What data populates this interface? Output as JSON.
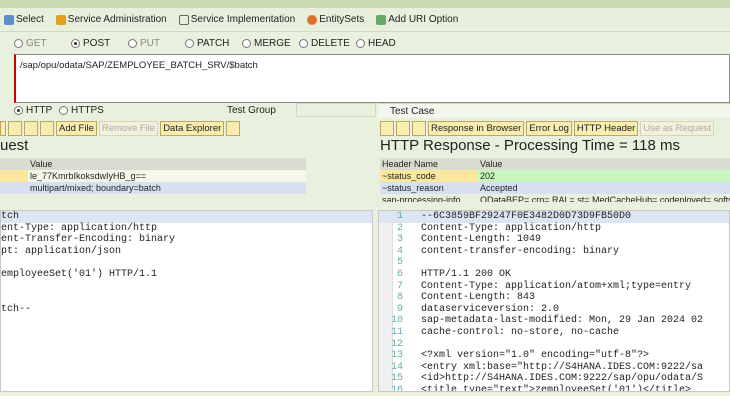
{
  "toolbar": {
    "items": [
      {
        "label": "Select",
        "icon": "select-icon"
      },
      {
        "label": "Service Administration",
        "icon": "service-admin-icon"
      },
      {
        "label": "Service Implementation",
        "icon": "service-impl-icon"
      },
      {
        "label": "EntitySets",
        "icon": "entitysets-icon"
      },
      {
        "label": "Add URI Option",
        "icon": "add-uri-icon"
      }
    ]
  },
  "methods": [
    {
      "label": "GET",
      "selected": false
    },
    {
      "label": "POST",
      "selected": true
    },
    {
      "label": "PUT",
      "selected": false
    },
    {
      "label": "PATCH",
      "selected": false
    },
    {
      "label": "MERGE",
      "selected": false
    },
    {
      "label": "DELETE",
      "selected": false
    },
    {
      "label": "HEAD",
      "selected": false
    }
  ],
  "url": "/sap/opu/odata/SAP/ZEMPLOYEE_BATCH_SRV/$batch",
  "protocols": [
    {
      "label": "HTTP",
      "selected": true
    },
    {
      "label": "HTTPS",
      "selected": false
    }
  ],
  "test_group_label": "Test Group",
  "test_case_label": "Test Case",
  "request": {
    "buttons": {
      "add_file": "Add File",
      "remove_file": "Remove File",
      "data_explorer": "Data Explorer"
    },
    "title": "uest",
    "col_value": "Value",
    "rows": [
      "le_77KmrbIkoksdwIyHB_g==",
      "multipart/mixed; boundary=batch"
    ],
    "body": [
      "tch",
      "ent-Type: application/http",
      "ent-Transfer-Encoding: binary",
      "pt: application/json",
      "",
      "employeeSet('01') HTTP/1.1",
      "",
      "",
      "tch--"
    ]
  },
  "response": {
    "buttons": {
      "response_in_browser": "Response in Browser",
      "error_log": "Error Log",
      "http_header": "HTTP Header",
      "use_as_request": "Use as Request"
    },
    "title": "HTTP Response - Processing Time = 118  ms",
    "col_name": "Header Name",
    "col_value": "Value",
    "rows": [
      {
        "name": "~status_code",
        "value": "202"
      },
      {
        "name": "~status_reason",
        "value": "Accepted"
      },
      {
        "name": "sap-processing-info",
        "value": "ODataBEP=,crp=,RAL=,st=,MedCacheHub=,codeployed=,softstate="
      }
    ],
    "body": [
      "--6C3859BF29247F0E3482D0D73D9FB50D0",
      "Content-Type: application/http",
      "Content-Length: 1049",
      "content-transfer-encoding: binary",
      "",
      "HTTP/1.1 200 OK",
      "Content-Type: application/atom+xml;type=entry",
      "Content-Length: 843",
      "dataserviceversion: 2.0",
      "sap-metadata-last-modified: Mon, 29 Jan 2024 02",
      "cache-control: no-store, no-cache",
      "",
      "<?xml version=\"1.0\" encoding=\"utf-8\"?>",
      "<entry xml:base=\"http://S4HANA.IDES.COM:9222/sa",
      "<id>http://S4HANA.IDES.COM:9222/sap/opu/odata/S",
      "<title type=\"text\">zemployeeSet('01')</title>"
    ]
  }
}
